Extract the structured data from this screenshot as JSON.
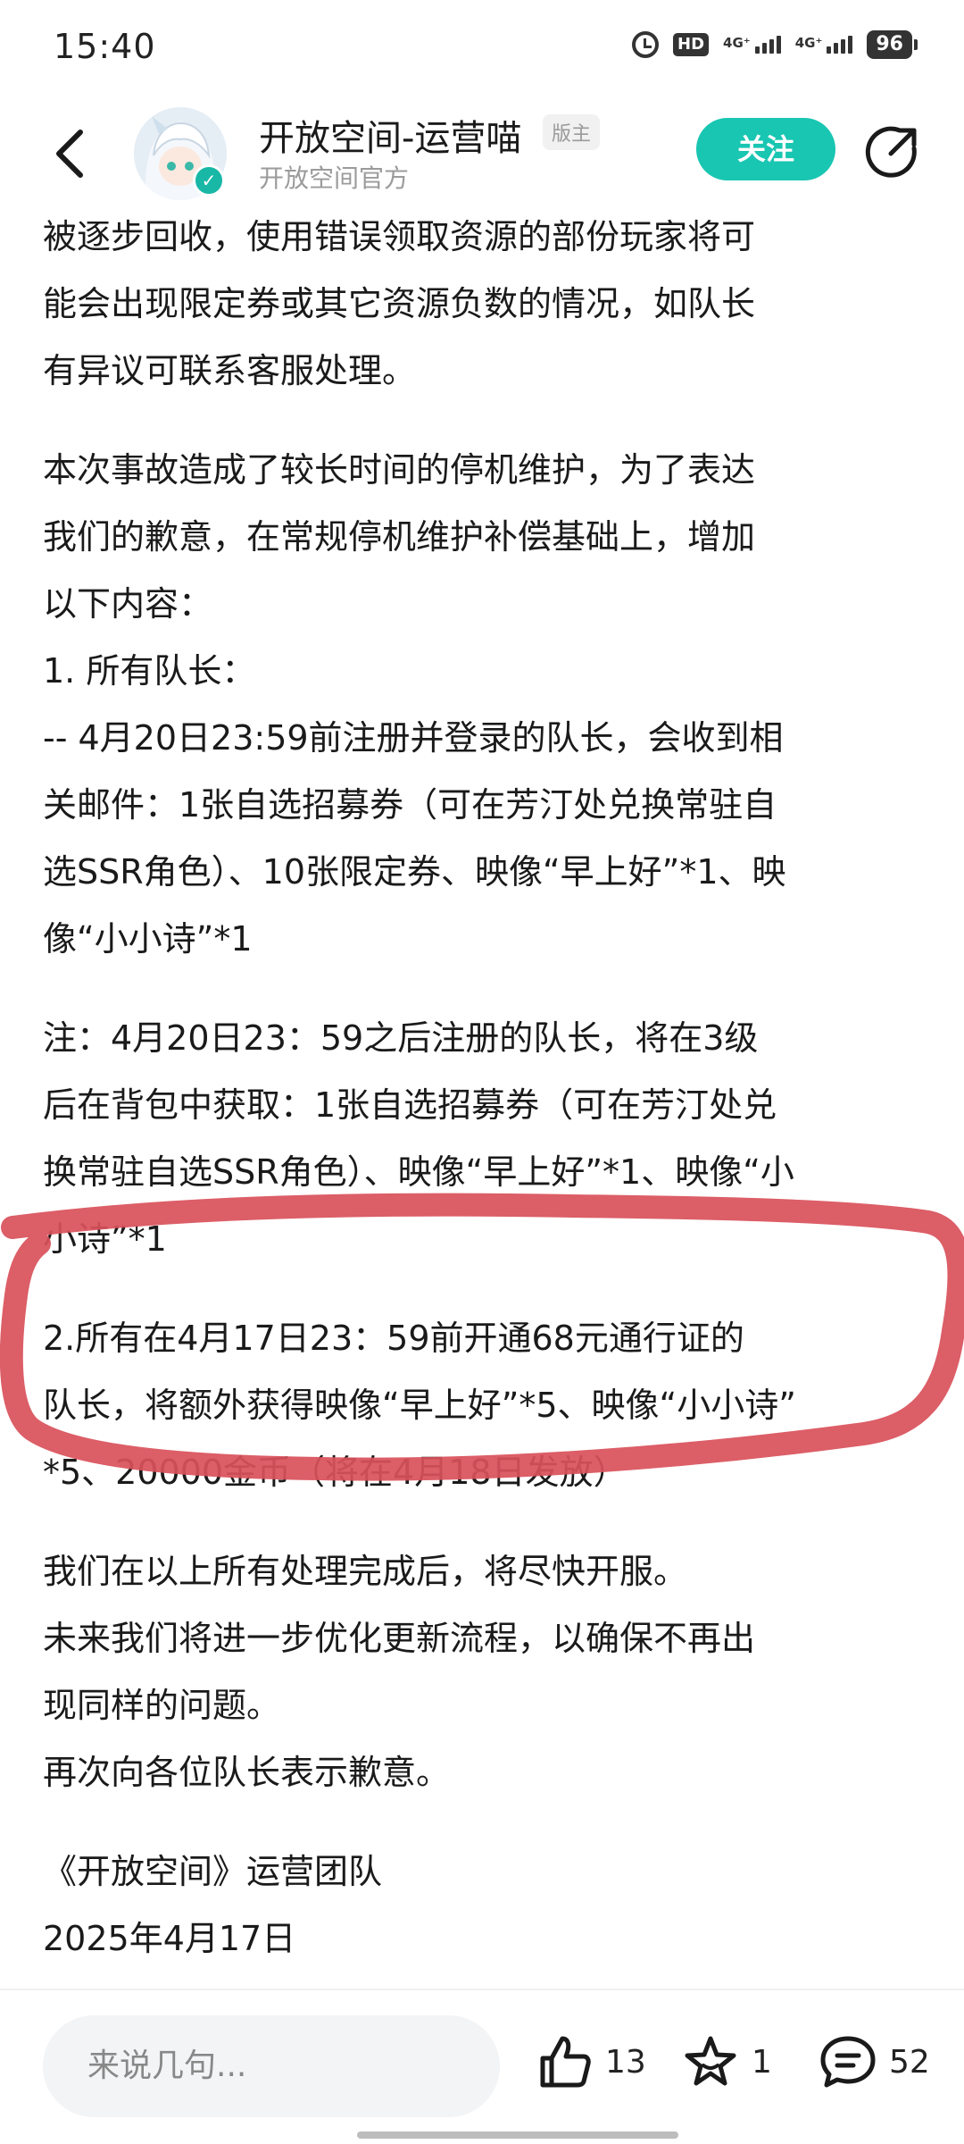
{
  "status_bar": {
    "time": "15:40",
    "hd_label": "HD",
    "net1_label": "4G⁺",
    "net2_label": "4G⁺",
    "battery": "96"
  },
  "header": {
    "author_name": "开放空间-运营喵",
    "author_tag": "版主",
    "author_subtitle": "开放空间官方",
    "follow_label": "关注"
  },
  "article": {
    "paragraphs": [
      "被逐步回收，使用错误领取资源的部份玩家将可\n能会出现限定券或其它资源负数的情况，如队长\n有异议可联系客服处理。",
      "本次事故造成了较长时间的停机维护，为了表达\n我们的歉意，在常规停机维护补偿基础上，增加\n以下内容：\n1. 所有队长：\n-- 4月20日23:59前注册并登录的队长，会收到相\n关邮件：1张自选招募券（可在芳汀处兑换常驻自\n选SSR角色）、10张限定券、映像“早上好”*1、映\n像“小小诗”*1",
      "注：4月20日23：59之后注册的队长，将在3级\n后在背包中获取：1张自选招募券（可在芳汀处兑\n换常驻自选SSR角色）、映像“早上好”*1、映像“小\n小诗”*1",
      "2.所有在4月17日23：59前开通68元通行证的\n队长，将额外获得映像“早上好”*5、映像“小小诗”\n*5、20000金币（将在4月18日发放）",
      "我们在以上所有处理完成后，将尽快开服。\n未来我们将进一步优化更新流程，以确保不再出\n现同样的问题。\n再次向各位队长表示歉意。",
      "《开放空间》运营团队\n2025年4月17日"
    ]
  },
  "bottom_bar": {
    "comment_placeholder": "来说几句...",
    "like_count": "13",
    "favorite_count": "1",
    "comment_count": "52"
  },
  "colors": {
    "accent": "#19c6b2",
    "annotation_red": "#d9505a"
  },
  "icons": [
    "back-arrow-icon",
    "verified-icon",
    "share-icon",
    "thumbs-up-icon",
    "star-icon",
    "comment-bubble-icon",
    "alarm-icon"
  ]
}
